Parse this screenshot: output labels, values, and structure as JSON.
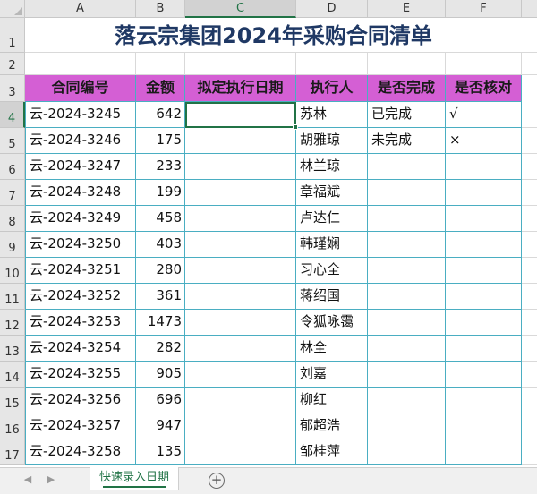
{
  "spreadsheet": {
    "columns": [
      "A",
      "B",
      "C",
      "D",
      "E",
      "F"
    ],
    "rows": [
      "1",
      "2",
      "3",
      "4",
      "5",
      "6",
      "7",
      "8",
      "9",
      "10",
      "11",
      "12",
      "13",
      "14",
      "15",
      "16",
      "17"
    ],
    "title": "落云宗集团2024年采购合同清单",
    "headers": [
      "合同编号",
      "金额",
      "拟定执行日期",
      "执行人",
      "是否完成",
      "是否核对"
    ],
    "data_rows": [
      {
        "id": "云-2024-3245",
        "amount": "642",
        "date": "",
        "person": "苏林",
        "done": "已完成",
        "checked": "√"
      },
      {
        "id": "云-2024-3246",
        "amount": "175",
        "date": "",
        "person": "胡雅琼",
        "done": "未完成",
        "checked": "×"
      },
      {
        "id": "云-2024-3247",
        "amount": "233",
        "date": "",
        "person": "林兰琼",
        "done": "",
        "checked": ""
      },
      {
        "id": "云-2024-3248",
        "amount": "199",
        "date": "",
        "person": "章福斌",
        "done": "",
        "checked": ""
      },
      {
        "id": "云-2024-3249",
        "amount": "458",
        "date": "",
        "person": "卢达仁",
        "done": "",
        "checked": ""
      },
      {
        "id": "云-2024-3250",
        "amount": "403",
        "date": "",
        "person": "韩瑾娴",
        "done": "",
        "checked": ""
      },
      {
        "id": "云-2024-3251",
        "amount": "280",
        "date": "",
        "person": "习心全",
        "done": "",
        "checked": ""
      },
      {
        "id": "云-2024-3252",
        "amount": "361",
        "date": "",
        "person": "蒋绍国",
        "done": "",
        "checked": ""
      },
      {
        "id": "云-2024-3253",
        "amount": "1473",
        "date": "",
        "person": "令狐咏霭",
        "done": "",
        "checked": ""
      },
      {
        "id": "云-2024-3254",
        "amount": "282",
        "date": "",
        "person": "林全",
        "done": "",
        "checked": ""
      },
      {
        "id": "云-2024-3255",
        "amount": "905",
        "date": "",
        "person": "刘嘉",
        "done": "",
        "checked": ""
      },
      {
        "id": "云-2024-3256",
        "amount": "696",
        "date": "",
        "person": "柳红",
        "done": "",
        "checked": ""
      },
      {
        "id": "云-2024-3257",
        "amount": "947",
        "date": "",
        "person": "郁超浩",
        "done": "",
        "checked": ""
      },
      {
        "id": "云-2024-3258",
        "amount": "135",
        "date": "",
        "person": "邹桂萍",
        "done": "",
        "checked": ""
      }
    ],
    "active_cell": "C4"
  },
  "sheet_tabs": {
    "tabs": [
      {
        "label": "快速录入日期"
      }
    ],
    "nav_prev_icon": "triangle-left-icon",
    "nav_next_icon": "triangle-right-icon",
    "add_icon": "plus-circle-icon",
    "add_glyph": "+"
  },
  "colors": {
    "header_fill": "#d45fd4",
    "table_border": "#4aaec2",
    "title_text": "#1f3864",
    "selection": "#217346"
  }
}
